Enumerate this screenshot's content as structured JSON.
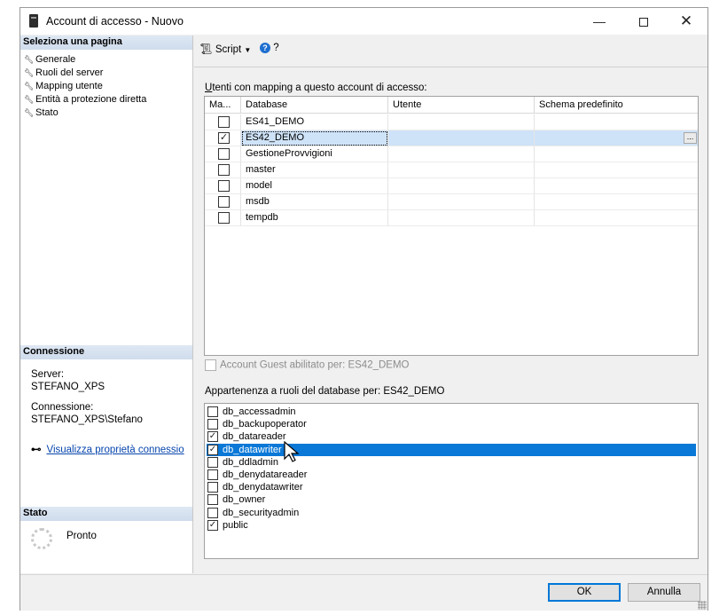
{
  "window": {
    "title": "Account di accesso - Nuovo",
    "min_glyph": "—",
    "close_glyph": "✕"
  },
  "left": {
    "select_page_header": "Seleziona una pagina",
    "pages": [
      {
        "label": "Generale",
        "icon": "wrench-icon"
      },
      {
        "label": "Ruoli del server",
        "icon": "wrench-icon"
      },
      {
        "label": "Mapping utente",
        "icon": "wrench-icon"
      },
      {
        "label": "Entità a protezione diretta",
        "icon": "wrench-icon"
      },
      {
        "label": "Stato",
        "icon": "wrench-icon"
      }
    ],
    "connection_header": "Connessione",
    "server_label": "Server:",
    "server_value": "STEFANO_XPS",
    "connection_label": "Connessione:",
    "connection_value": "STEFANO_XPS\\Stefano",
    "view_props_link": "Visualizza proprietà connessio",
    "status_header": "Stato",
    "status_value": "Pronto"
  },
  "toolbar": {
    "script_label": "Script",
    "help_glyph": "?",
    "help_after": "?"
  },
  "mapping": {
    "label_prefix": "U",
    "label_rest": "tenti con mapping a questo account di accesso:",
    "columns": [
      "Ma...",
      "Database",
      "Utente",
      "Schema predefinito"
    ],
    "rows": [
      {
        "mapped": false,
        "database": "ES41_DEMO",
        "user": "",
        "schema": ""
      },
      {
        "mapped": true,
        "database": "ES42_DEMO",
        "user": "",
        "schema": ""
      },
      {
        "mapped": false,
        "database": "GestioneProvvigioni",
        "user": "",
        "schema": ""
      },
      {
        "mapped": false,
        "database": "master",
        "user": "",
        "schema": ""
      },
      {
        "mapped": false,
        "database": "model",
        "user": "",
        "schema": ""
      },
      {
        "mapped": false,
        "database": "msdb",
        "user": "",
        "schema": ""
      },
      {
        "mapped": false,
        "database": "tempdb",
        "user": "",
        "schema": ""
      }
    ],
    "ellipsis": "...",
    "check_glyph": "✓"
  },
  "guest": {
    "label": "Account Guest abilitato per: ES42_DEMO"
  },
  "roles": {
    "label": "Appartenenza a ruoli del database per: ES42_DEMO",
    "items": [
      {
        "name": "db_accessadmin",
        "checked": false,
        "selected": false
      },
      {
        "name": "db_backupoperator",
        "checked": false,
        "selected": false
      },
      {
        "name": "db_datareader",
        "checked": true,
        "selected": false
      },
      {
        "name": "db_datawriter",
        "checked": true,
        "selected": true
      },
      {
        "name": "db_ddladmin",
        "checked": false,
        "selected": false
      },
      {
        "name": "db_denydatareader",
        "checked": false,
        "selected": false
      },
      {
        "name": "db_denydatawriter",
        "checked": false,
        "selected": false
      },
      {
        "name": "db_owner",
        "checked": false,
        "selected": false
      },
      {
        "name": "db_securityadmin",
        "checked": false,
        "selected": false
      },
      {
        "name": "public",
        "checked": true,
        "selected": false
      }
    ]
  },
  "footer": {
    "ok_label": "OK",
    "cancel_label": "Annulla"
  },
  "colors": {
    "selection": "#0a78d7",
    "grid_selection": "#cfe3f8",
    "link": "#0645ad",
    "section_header": "#dfe8f4"
  }
}
